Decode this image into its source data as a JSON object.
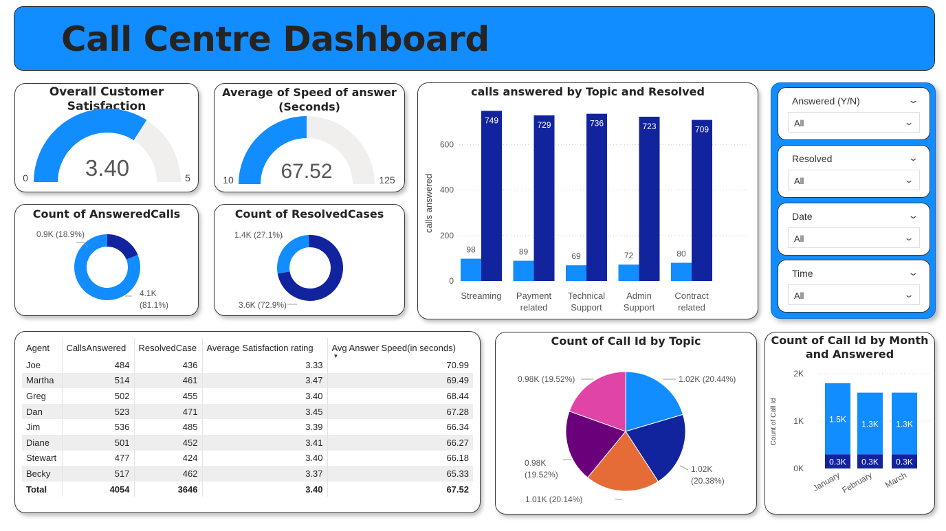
{
  "header": {
    "title": "Call Centre Dashboard"
  },
  "colors": {
    "header_bg": "#118dff",
    "accent_blue": "#118dff",
    "dark_blue": "#12239e",
    "gauge_bg": "#f0efee",
    "purple": "#6b007b",
    "orange": "#e66c37",
    "pink": "#e044a7"
  },
  "satisfaction_gauge": {
    "title": "Overall Customer Satisfaction",
    "value": "3.40",
    "min": "0",
    "max": "5",
    "fill_fraction": 0.68
  },
  "speed_gauge": {
    "title_line1": "Average of Speed of answer",
    "title_line2": "(Seconds)",
    "value": "67.52",
    "min": "10",
    "max": "125",
    "fill_fraction": 0.5
  },
  "answered_donut": {
    "title": "Count of AnsweredCalls",
    "label_small": "0.9K (18.9%)",
    "label_large_line1": "4.1K",
    "label_large_line2": "(81.1%)",
    "small_fraction": 0.189
  },
  "resolved_donut": {
    "title": "Count of ResolvedCases",
    "label_small": "1.4K (27.1%)",
    "label_large": "3.6K (72.9%)",
    "small_fraction": 0.271
  },
  "chart_data": [
    {
      "type": "bar",
      "title": "calls answered by Topic and Resolved",
      "ylabel": "calls answered",
      "xlabel": "",
      "categories": [
        "Streaming",
        "Payment related",
        "Technical Support",
        "Admin Support",
        "Contract related"
      ],
      "category_lines": [
        [
          "Streaming"
        ],
        [
          "Payment",
          "related"
        ],
        [
          "Technical",
          "Support"
        ],
        [
          "Admin",
          "Support"
        ],
        [
          "Contract",
          "related"
        ]
      ],
      "series": [
        {
          "values": [
            98,
            89,
            69,
            72,
            80
          ]
        },
        {
          "values": [
            749,
            729,
            736,
            723,
            709
          ]
        }
      ],
      "ylim": [
        0,
        750
      ],
      "yticks": [
        0,
        200,
        400,
        600
      ]
    },
    {
      "type": "pie",
      "title": "Count of Call Id by Topic",
      "slices": [
        {
          "label": "1.02K (20.44%)",
          "value": 20.44,
          "color": "#118dff"
        },
        {
          "label": "1.02K (20.38%)",
          "value": 20.38,
          "color": "#12239e"
        },
        {
          "label": "1.01K (20.14%)",
          "value": 20.14,
          "color": "#e66c37"
        },
        {
          "label": "0.98K (19.52%)",
          "value": 19.52,
          "color": "#6b007b"
        },
        {
          "label": "0.98K (19.52%)",
          "value": 19.52,
          "color": "#e044a7"
        }
      ],
      "label_lines": [
        [
          "1.02K (20.44%)"
        ],
        [
          "1.02K",
          "(20.38%)"
        ],
        [
          "1.01K (20.14%)"
        ],
        [
          "0.98K",
          "(19.52%)"
        ],
        [
          "0.98K (19.52%)"
        ]
      ]
    },
    {
      "type": "bar",
      "stacked": true,
      "title": "Count of Call Id by Month and Answered",
      "ylabel": "Count of Call Id",
      "categories": [
        "January",
        "February",
        "March"
      ],
      "series": [
        {
          "values": [
            300,
            300,
            300
          ],
          "labels": [
            "0.3K",
            "0.3K",
            "0.3K"
          ]
        },
        {
          "values": [
            1500,
            1300,
            1300
          ],
          "labels": [
            "1.5K",
            "1.3K",
            "1.3K"
          ]
        }
      ],
      "ylim": [
        0,
        2000
      ],
      "yticks": [
        "0K",
        "1K",
        "2K"
      ]
    }
  ],
  "slicers": [
    {
      "label": "Answered (Y/N)",
      "value": "All"
    },
    {
      "label": "Resolved",
      "value": "All"
    },
    {
      "label": "Date",
      "value": "All"
    },
    {
      "label": "Time",
      "value": "All"
    }
  ],
  "table": {
    "columns": [
      "Agent",
      "CallsAnswered",
      "ResolvedCase",
      "Average Satisfaction rating",
      "Avg Answer Speed(in seconds)"
    ],
    "rows": [
      [
        "Joe",
        "484",
        "436",
        "3.33",
        "70.99"
      ],
      [
        "Martha",
        "514",
        "461",
        "3.47",
        "69.49"
      ],
      [
        "Greg",
        "502",
        "455",
        "3.40",
        "68.44"
      ],
      [
        "Dan",
        "523",
        "471",
        "3.45",
        "67.28"
      ],
      [
        "Jim",
        "536",
        "485",
        "3.39",
        "66.34"
      ],
      [
        "Diane",
        "501",
        "452",
        "3.41",
        "66.27"
      ],
      [
        "Stewart",
        "477",
        "424",
        "3.40",
        "66.18"
      ],
      [
        "Becky",
        "517",
        "462",
        "3.37",
        "65.33"
      ]
    ],
    "total": [
      "Total",
      "4054",
      "3646",
      "3.40",
      "67.52"
    ]
  }
}
